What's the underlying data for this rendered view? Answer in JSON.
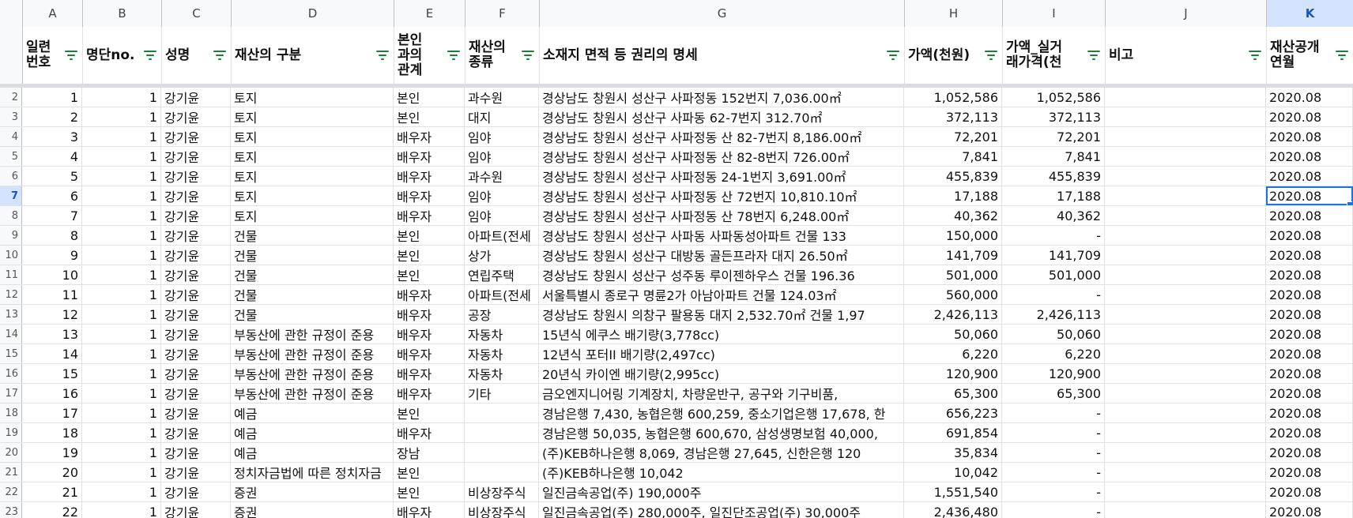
{
  "columns": [
    {
      "letter": "A",
      "width": 76
    },
    {
      "letter": "B",
      "width": 100
    },
    {
      "letter": "C",
      "width": 88
    },
    {
      "letter": "D",
      "width": 206
    },
    {
      "letter": "E",
      "width": 90
    },
    {
      "letter": "F",
      "width": 94
    },
    {
      "letter": "G",
      "width": 462
    },
    {
      "letter": "H",
      "width": 124
    },
    {
      "letter": "I",
      "width": 130
    },
    {
      "letter": "J",
      "width": 204
    },
    {
      "letter": "K",
      "width": 110
    }
  ],
  "selected_column": "K",
  "headers": [
    "일련\n번호",
    "명단no.",
    "성명",
    "재산의 구분",
    "본인\n과의\n관계",
    "재산의\n종류",
    "소재지 면적 등 권리의 명세",
    "가액(천원)",
    "가액_실거\n래가격(천",
    "비고",
    "재산공개\n연월"
  ],
  "row_numbers": [
    "2",
    "3",
    "4",
    "5",
    "6",
    "7",
    "8",
    "9",
    "10",
    "11",
    "12",
    "13",
    "14",
    "15",
    "16",
    "17",
    "18",
    "19",
    "20",
    "21",
    "22",
    "23"
  ],
  "selected_row_index": 5,
  "rows": [
    [
      "1",
      "1",
      "강기윤",
      "토지",
      "본인",
      "과수원",
      "경상남도 창원시 성산구 사파정동 152번지 7,036.00㎡",
      "1,052,586",
      "1,052,586",
      "",
      "2020.08"
    ],
    [
      "2",
      "1",
      "강기윤",
      "토지",
      "본인",
      "대지",
      "경상남도 창원시 성산구 사파동 62-7번지 312.70㎡",
      "372,113",
      "372,113",
      "",
      "2020.08"
    ],
    [
      "3",
      "1",
      "강기윤",
      "토지",
      "배우자",
      "임야",
      "경상남도 창원시 성산구 사파정동 산 82-7번지 8,186.00㎡",
      "72,201",
      "72,201",
      "",
      "2020.08"
    ],
    [
      "4",
      "1",
      "강기윤",
      "토지",
      "배우자",
      "임야",
      "경상남도 창원시 성산구 사파정동 산 82-8번지 726.00㎡",
      "7,841",
      "7,841",
      "",
      "2020.08"
    ],
    [
      "5",
      "1",
      "강기윤",
      "토지",
      "배우자",
      "과수원",
      "경상남도 창원시 성산구 사파정동 24-1번지 3,691.00㎡",
      "455,839",
      "455,839",
      "",
      "2020.08"
    ],
    [
      "6",
      "1",
      "강기윤",
      "토지",
      "배우자",
      "임야",
      "경상남도 창원시 성산구 사파정동 산 72번지 10,810.10㎡",
      "17,188",
      "17,188",
      "",
      "2020.08"
    ],
    [
      "7",
      "1",
      "강기윤",
      "토지",
      "배우자",
      "임야",
      "경상남도 창원시 성산구 사파정동 산 78번지 6,248.00㎡",
      "40,362",
      "40,362",
      "",
      "2020.08"
    ],
    [
      "8",
      "1",
      "강기윤",
      "건물",
      "본인",
      "아파트(전세",
      "경상남도 창원시 성산구 사파동  사파동성아파트 건물 133",
      "150,000",
      "-",
      "",
      "2020.08"
    ],
    [
      "9",
      "1",
      "강기윤",
      "건물",
      "본인",
      "상가",
      "경상남도 창원시 성산구 대방동  골든프라자 대지 26.50㎡",
      "141,709",
      "141,709",
      "",
      "2020.08"
    ],
    [
      "10",
      "1",
      "강기윤",
      "건물",
      "본인",
      "연립주택",
      "경상남도 창원시 성산구 성주동 루이젠하우스 건물 196.36",
      "501,000",
      "501,000",
      "",
      "2020.08"
    ],
    [
      "11",
      "1",
      "강기윤",
      "건물",
      "배우자",
      "아파트(전세",
      "서울특별시 종로구 명륜2가  아남아파트 건물 124.03㎡",
      "560,000",
      "-",
      "",
      "2020.08"
    ],
    [
      "12",
      "1",
      "강기윤",
      "건물",
      "배우자",
      "공장",
      "경상남도 창원시 의창구 팔용동 대지 2,532.70㎡ 건물 1,97",
      "2,426,113",
      "2,426,113",
      "",
      "2020.08"
    ],
    [
      "13",
      "1",
      "강기윤",
      "부동산에 관한 규정이 준용",
      "배우자",
      "자동차",
      "15년식 에쿠스 배기량(3,778cc)",
      "50,060",
      "50,060",
      "",
      "2020.08"
    ],
    [
      "14",
      "1",
      "강기윤",
      "부동산에 관한 규정이 준용",
      "배우자",
      "자동차",
      "12년식 포터II 배기량(2,497cc)",
      "6,220",
      "6,220",
      "",
      "2020.08"
    ],
    [
      "15",
      "1",
      "강기윤",
      "부동산에 관한 규정이 준용",
      "배우자",
      "자동차",
      "20년식 카이엔 배기량(2,995cc)",
      "120,900",
      "120,900",
      "",
      "2020.08"
    ],
    [
      "16",
      "1",
      "강기윤",
      "부동산에 관한 규정이 준용",
      "배우자",
      "기타",
      "금오엔지니어링 기계장치, 차량운반구, 공구와 기구비품,",
      "65,300",
      "65,300",
      "",
      "2020.08"
    ],
    [
      "17",
      "1",
      "강기윤",
      "예금",
      "본인",
      "",
      "경남은행 7,430, 농협은행 600,259, 중소기업은행 17,678, 한",
      "656,223",
      "-",
      "",
      "2020.08"
    ],
    [
      "18",
      "1",
      "강기윤",
      "예금",
      "배우자",
      "",
      "경남은행 50,035, 농협은행 600,670, 삼성생명보험 40,000,",
      "691,854",
      "-",
      "",
      "2020.08"
    ],
    [
      "19",
      "1",
      "강기윤",
      "예금",
      "장남",
      "",
      "(주)KEB하나은행 8,069, 경남은행 27,645, 신한은행 120",
      "35,834",
      "-",
      "",
      "2020.08"
    ],
    [
      "20",
      "1",
      "강기윤",
      "정치자금법에 따른 정치자금",
      "본인",
      "",
      "(주)KEB하나은행 10,042",
      "10,042",
      "-",
      "",
      "2020.08"
    ],
    [
      "21",
      "1",
      "강기윤",
      "증권",
      "본인",
      "비상장주식",
      "일진금속공업(주) 190,000주",
      "1,551,540",
      "-",
      "",
      "2020.08"
    ],
    [
      "22",
      "1",
      "강기윤",
      "증권",
      "배우자",
      "비상장주식",
      "일진금속공업(주) 280,000주, 일진단조공업(주) 30,000주",
      "2,436,480",
      "-",
      "",
      "2020.08"
    ]
  ],
  "numeric_columns": [
    0,
    1,
    7,
    8
  ]
}
